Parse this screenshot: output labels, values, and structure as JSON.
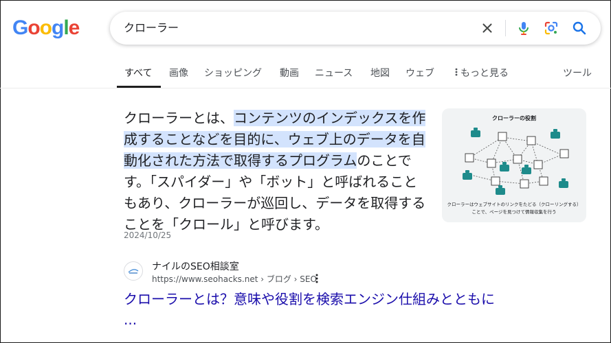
{
  "logo": {
    "letters": [
      "G",
      "o",
      "o",
      "g",
      "l",
      "e"
    ],
    "colors": [
      "#4285f4",
      "#ea4335",
      "#fbbc05",
      "#4285f4",
      "#34a853",
      "#ea4335"
    ]
  },
  "search": {
    "query": "クローラー",
    "accent": "#1a73e8"
  },
  "tabs": [
    {
      "label": "すべて"
    },
    {
      "label": "画像"
    },
    {
      "label": "ショッピング"
    },
    {
      "label": "動画"
    },
    {
      "label": "ニュース"
    },
    {
      "label": "地図"
    },
    {
      "label": "ウェブ"
    },
    {
      "label": "もっと見る"
    },
    {
      "label": "ツール"
    }
  ],
  "snippet": {
    "lead": "クローラーとは、",
    "highlight": "コンテンツのインデックスを作成することなどを目的に、ウェブ上のデータを自動化された方法で取得するプログラム",
    "rest": "のことです。「スパイダー」や「ボット」と呼ばれることもあり、クローラーが巡回し、データを取得することを「クロール」と呼びます。",
    "date": "2024/10/25",
    "highlight_color": "#d3e3fd"
  },
  "thumbnail": {
    "title": "クローラーの役割",
    "caption_line1": "クローラーはウェブサイトのリンクをたどる（クローリングする）",
    "caption_line2": "ことで、ページを見つけて情報収集を行う",
    "robot_color": "#1e8b8b"
  },
  "result": {
    "site_name": "ナイルのSEO相談室",
    "url": "https://www.seohacks.net › ブログ › SEO",
    "title_line1": "クローラーとは？意味や役割を検索エンジン仕組みとともに",
    "title_line2": "...",
    "link_color": "#1a0dab"
  }
}
